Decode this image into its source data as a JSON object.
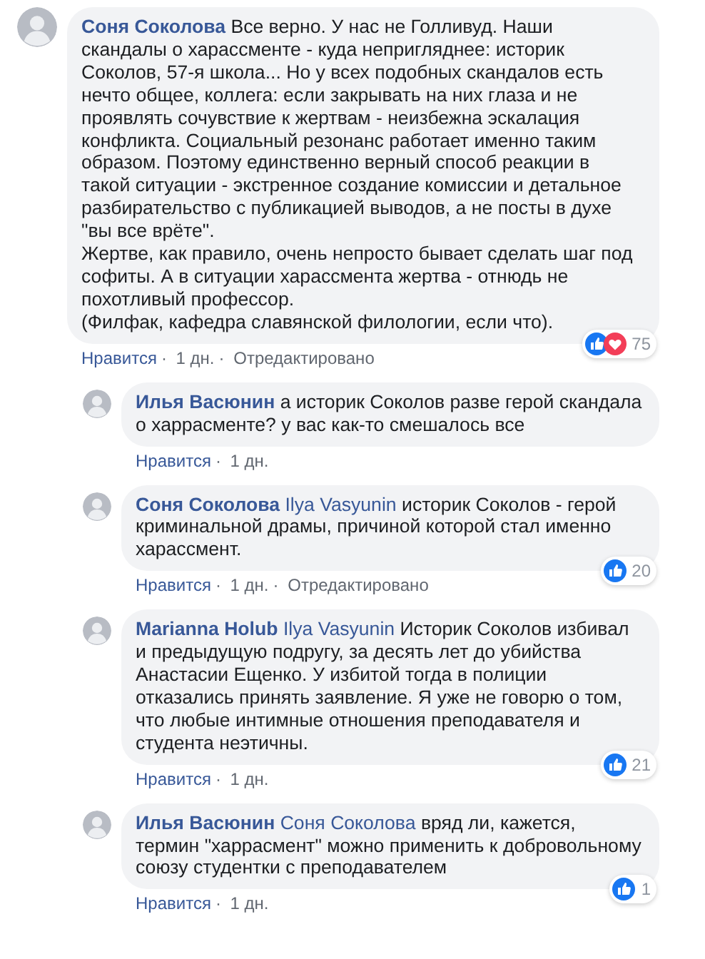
{
  "action_separator": "·",
  "comments": [
    {
      "author": "Соня Соколова",
      "reply": false,
      "paragraphs": [
        "Все верно. У нас не Голливуд. Наши скандалы о харассменте - куда непригляднее: историк Соколов, 57-я школа... Но у всех подобных скандалов есть нечто общее, коллега: если закрывать на них глаза и не проявлять сочувствие к жертвам - неизбежна эскалация конфликта. Социальный резонанс работает именно таким образом. Поэтому единственно верный способ реакции в такой ситуации - экстренное создание комиссии и детальное разбирательство с публикацией выводов, а не посты в духе \"вы все врёте\".",
        "Жертве, как правило, очень непросто бывает сделать шаг под софиты. А в ситуации харассмента жертва - отнюдь не похотливый профессор.",
        "(Филфак, кафедра славянской филологии, если что)."
      ],
      "actions": [
        "Нравится",
        "1 дн.",
        "Отредактировано"
      ],
      "reactions": {
        "like": true,
        "love": true,
        "count": "75"
      }
    },
    {
      "author": "Илья Васюнин",
      "reply": true,
      "paragraphs": [
        "а историк Соколов разве герой скандала о харрасменте? у вас как-то смешалось все"
      ],
      "actions": [
        "Нравится",
        "1 дн."
      ]
    },
    {
      "author": "Соня Соколова",
      "reply": true,
      "mention": "Ilya Vasyunin",
      "paragraphs": [
        "историк Соколов - герой криминальной драмы, причиной которой стал именно харассмент."
      ],
      "actions": [
        "Нравится",
        "1 дн.",
        "Отредактировано"
      ],
      "reactions": {
        "like": true,
        "love": false,
        "count": "20"
      }
    },
    {
      "author": "Marianna Holub",
      "reply": true,
      "mention": "Ilya Vasyunin",
      "paragraphs": [
        "Историк Соколов избивал и предыдущую подругу, за десять лет до убийства Анастасии Ещенко. У избитой тогда в полиции отказались принять заявление. Я уже не говорю о том, что любые интимные отношения преподавателя и студента неэтичны."
      ],
      "actions": [
        "Нравится",
        "1 дн."
      ],
      "reactions": {
        "like": true,
        "love": false,
        "count": "21"
      }
    },
    {
      "author": "Илья Васюнин",
      "reply": true,
      "mention": "Соня Соколова",
      "paragraphs": [
        "вряд ли, кажется, термин \"харрасмент\" можно применить к добровольному союзу студентки с преподавателем"
      ],
      "actions": [
        "Нравится",
        "1 дн."
      ],
      "reactions": {
        "like": true,
        "love": false,
        "count": "1"
      }
    }
  ]
}
